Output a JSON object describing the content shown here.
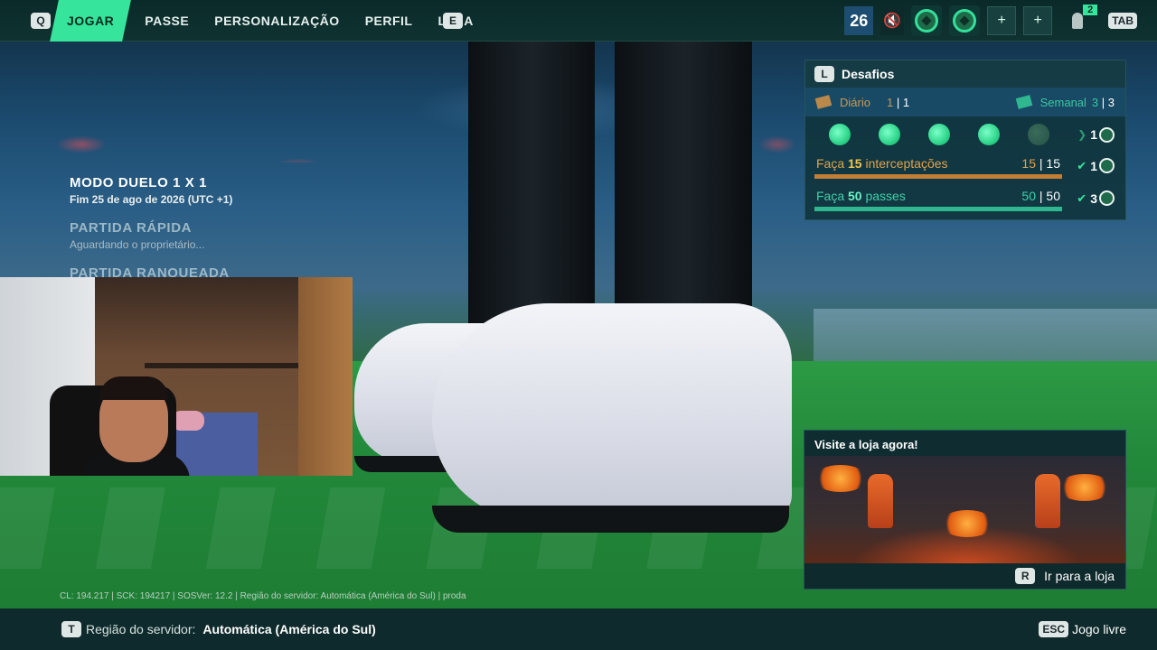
{
  "topbar": {
    "left_key": "Q",
    "right_key": "E",
    "nav": [
      "JOGAR",
      "PASSE",
      "PERSONALIZAÇÃO",
      "PERFIL",
      "LOJA"
    ],
    "active_index": 0,
    "level": "26",
    "mute_icon": "mute-icon",
    "add_label": "+",
    "friends_count": "2",
    "tab_key": "TAB"
  },
  "modes": {
    "title": "MODO DUELO 1 X 1",
    "subtitle": "Fim 25 de ago de 2026 (UTC +1)",
    "quick_title": "PARTIDA RÁPIDA",
    "quick_sub": "Aguardando o proprietário...",
    "ranked_title": "PARTIDA RANQUEADA"
  },
  "challenges": {
    "key": "L",
    "title": "Desafios",
    "daily_label": "Diário",
    "daily_done": "1",
    "daily_total": "1",
    "weekly_label": "Semanal",
    "weekly_done": "3",
    "weekly_total": "3",
    "dots_reward": "1",
    "tasks": [
      {
        "prefix": "Faça ",
        "amount": "15",
        "suffix": " interceptações",
        "done": "15",
        "total": "15",
        "reward": "1"
      },
      {
        "prefix": "Faça ",
        "amount": "50",
        "suffix": " passes",
        "done": "50",
        "total": "50",
        "reward": "3"
      }
    ]
  },
  "store": {
    "title": "Visite a loja agora!",
    "key": "R",
    "cta": "Ir para a loja"
  },
  "debug_text": "CL: 194.217 | SCK: 194217 | SOSVer: 12.2 | Região do servidor: Automática (América do Sul) | proda",
  "bottombar": {
    "key": "T",
    "label": "Região do servidor:",
    "value": "Automática (América do Sul)",
    "right_key": "ESC",
    "right_label": "Jogo livre"
  }
}
